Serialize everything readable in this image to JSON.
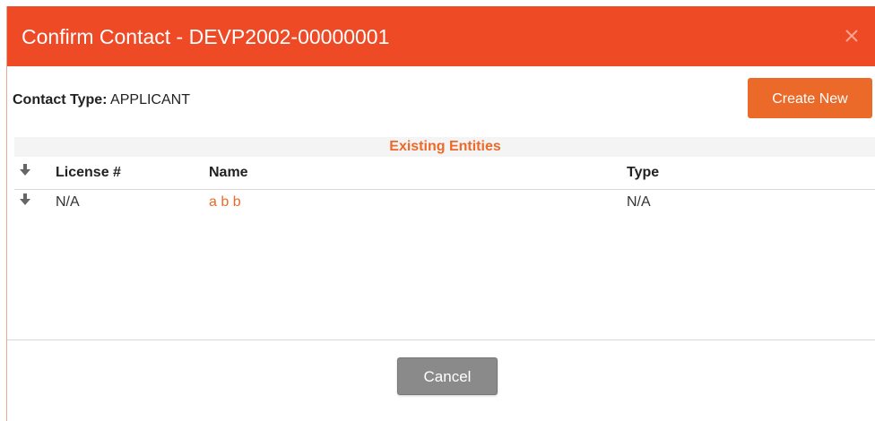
{
  "modal": {
    "title": "Confirm Contact - DEVP2002-00000001",
    "close_icon": "close-icon",
    "header_color": "#ee4a26"
  },
  "contact": {
    "type_label": "Contact Type:",
    "type_value": "APPLICANT"
  },
  "actions": {
    "create_new_label": "Create New",
    "cancel_label": "Cancel"
  },
  "table": {
    "section_title": "Existing Entities",
    "sort_icon": "sort-arrow-down-icon",
    "columns": [
      "License #",
      "Name",
      "Type"
    ],
    "rows": [
      {
        "license": "N/A",
        "name": "a b b",
        "type": "N/A"
      }
    ]
  },
  "colors": {
    "accent": "#ec6a29",
    "cancel_bg": "#8a8a8a"
  }
}
